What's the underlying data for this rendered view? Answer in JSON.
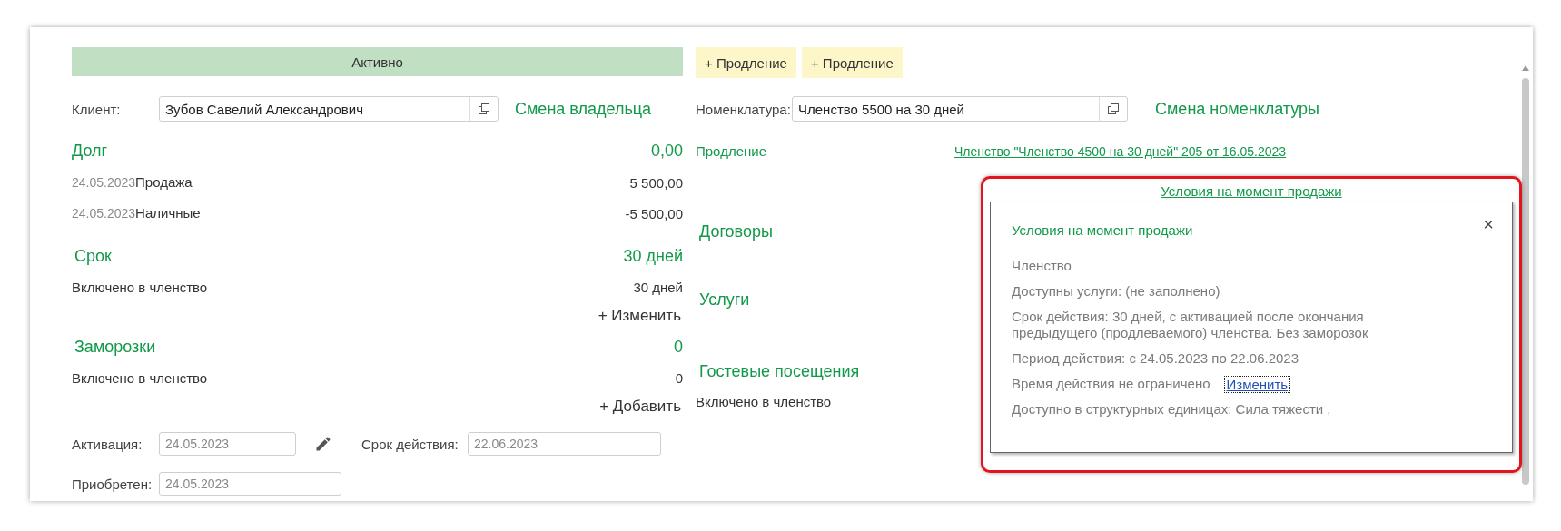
{
  "status_bar": {
    "label": "Активно"
  },
  "extension_buttons": [
    "+ Продление",
    "+ Продление"
  ],
  "client": {
    "label": "Клиент:",
    "value": "Зубов Савелий Александрович",
    "action": "Смена владельца"
  },
  "debt": {
    "title": "Долг",
    "total": "0,00",
    "entries": [
      {
        "date": "24.05.2023",
        "label": "Продажа",
        "amount": "5 500,00"
      },
      {
        "date": "24.05.2023",
        "label": "Наличные",
        "amount": "-5 500,00"
      }
    ]
  },
  "term": {
    "title": "Срок",
    "total": "30 дней",
    "rows": [
      {
        "label": "Включено в членство",
        "value": "30 дней"
      }
    ],
    "action": "+ Изменить"
  },
  "freezes": {
    "title": "Заморозки",
    "total": "0",
    "rows": [
      {
        "label": "Включено в членство",
        "value": "0"
      }
    ],
    "action": "+ Добавить"
  },
  "dates": [
    {
      "label": "Активация:",
      "value": "24.05.2023",
      "editable": true
    },
    {
      "label": "Срок действия:",
      "value": "22.06.2023",
      "editable": false
    },
    {
      "label": "Приобретен:",
      "value": "24.05.2023",
      "editable": false
    }
  ],
  "nomenclature": {
    "label": "Номенклатура:",
    "value": "Членство 5500 на 30 дней",
    "action": "Смена номенклатуры"
  },
  "renewal": {
    "label": "Продление",
    "link": "Членство \"Членство 4500 на 30 дней\" 205 от 16.05.2023"
  },
  "sections": [
    {
      "title": "Договоры"
    },
    {
      "title": "Услуги"
    },
    {
      "title": "Гостевые посещения",
      "note": "Включено в членство"
    }
  ],
  "conditions": {
    "link": "Условия на момент продажи",
    "title": "Условия на момент продажи",
    "close": "×",
    "lines": [
      {
        "text": "Членство"
      },
      {
        "text": "Доступны услуги: (не заполнено)"
      },
      {
        "text": "Срок действия: 30 дней, с активацией после окончания предыдущего (продлеваемого) членства. Без заморозок"
      },
      {
        "text": "Период действия: с 24.05.2023 по 22.06.2023"
      },
      {
        "text": "Время действия не ограничено",
        "link": "Изменить",
        "link_focused": true
      },
      {
        "text": "Доступно в структурных единицах: Сила тяжести ,"
      }
    ]
  }
}
